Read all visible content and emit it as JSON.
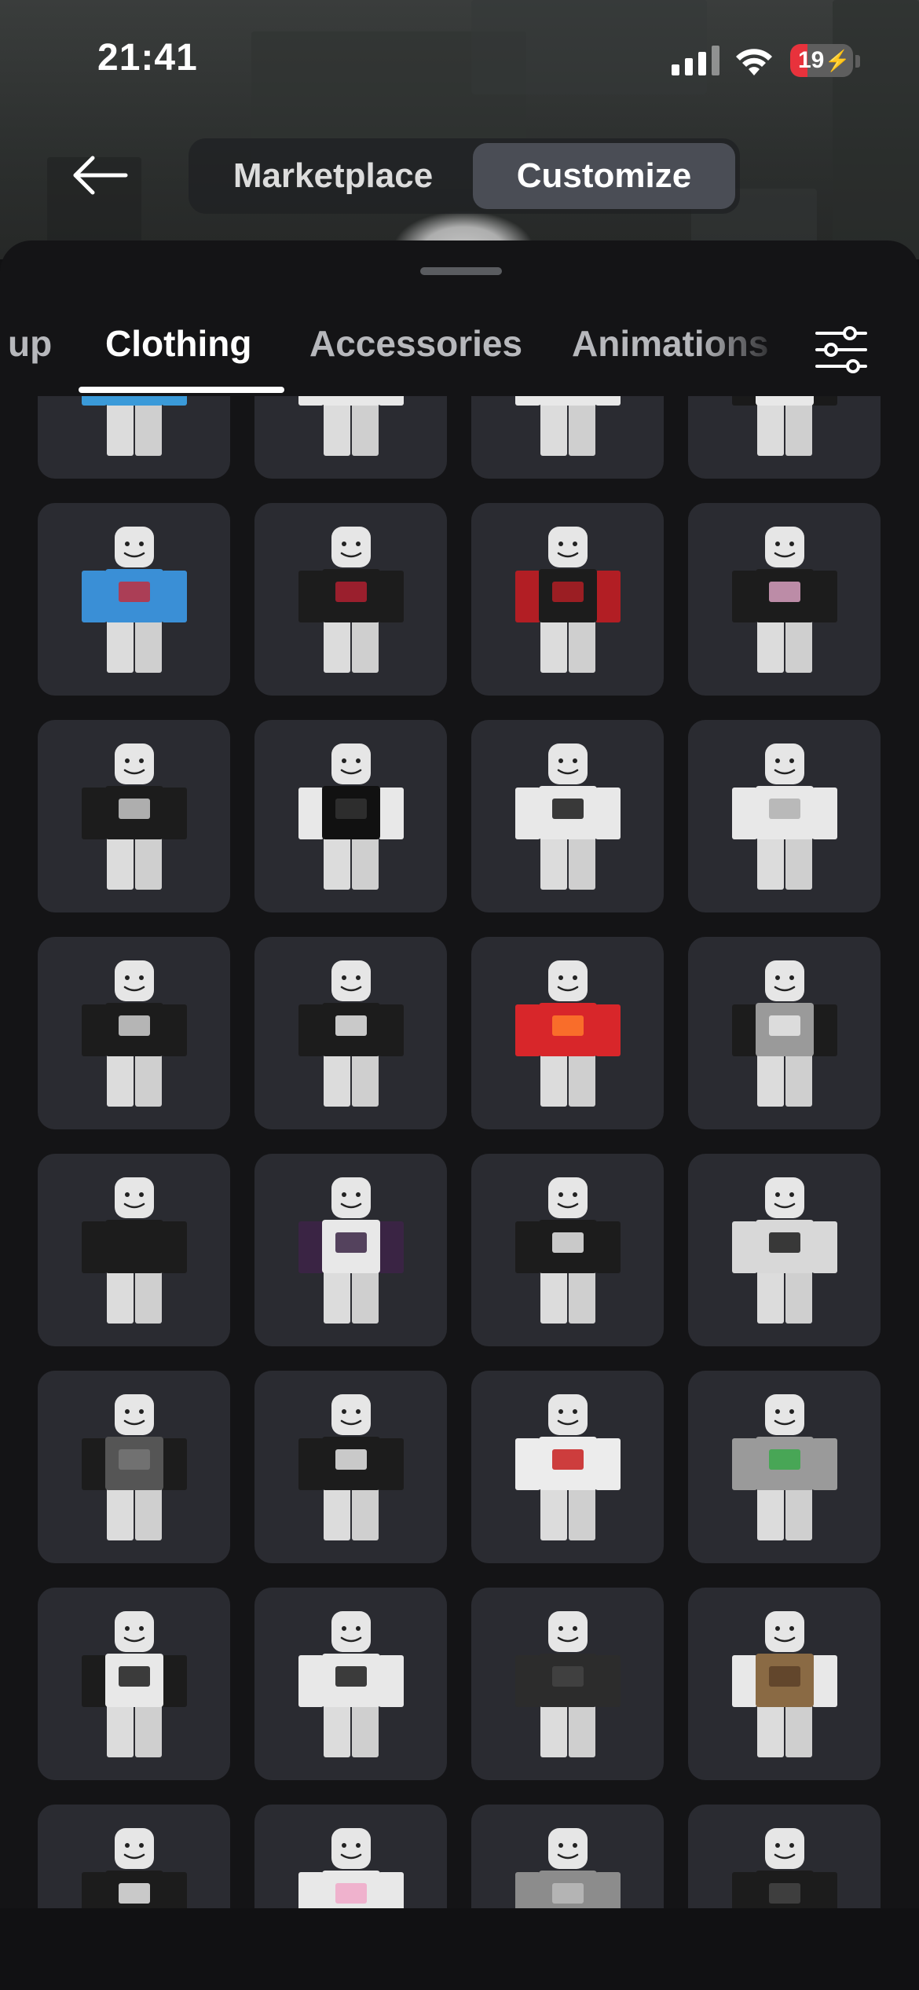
{
  "status_bar": {
    "time": "21:41",
    "battery": "19"
  },
  "nav": {
    "back_label": "←",
    "segments": [
      {
        "label": "Marketplace"
      },
      {
        "label": "Customize"
      }
    ],
    "active_segment": "Customize"
  },
  "tabs": [
    {
      "label": "up"
    },
    {
      "label": "Clothing"
    },
    {
      "label": "Accessories"
    },
    {
      "label": "Animations"
    }
  ],
  "active_tab": "Clothing",
  "colors": {
    "accent": "#ffffff",
    "tile_bg": "#2a2b31",
    "sheet_bg": "#141416",
    "active_segment_bg": "#4a4d55",
    "battery_low": "#e8323c"
  },
  "grid_items": [
    {
      "shirt": "#3a9ad9",
      "sleeve": "#3a9ad9",
      "print": "#d9d9d9"
    },
    {
      "shirt": "#e8e8e8",
      "sleeve": "#e8e8e8",
      "print": "#d0a0c0"
    },
    {
      "shirt": "#e8e8e8",
      "sleeve": "#e8e8e8",
      "print": "#d08030"
    },
    {
      "shirt": "#e8e8e8",
      "sleeve": "#1a1a1a",
      "print": "#1a1a1a"
    },
    {
      "shirt": "#3a8fd6",
      "sleeve": "#3a8fd6",
      "print": "#c03040"
    },
    {
      "shirt": "#1c1c1c",
      "sleeve": "#1c1c1c",
      "print": "#b02030"
    },
    {
      "shirt": "#1c1c1c",
      "sleeve": "#b21e24",
      "print": "#b21e24"
    },
    {
      "shirt": "#1c1c1c",
      "sleeve": "#1c1c1c",
      "print": "#d8a0c0"
    },
    {
      "shirt": "#1c1c1c",
      "sleeve": "#1c1c1c",
      "print": "#c8c8c8"
    },
    {
      "shirt": "#111111",
      "sleeve": "#e8e8e8",
      "print": "#333333"
    },
    {
      "shirt": "#e8e8e8",
      "sleeve": "#e8e8e8",
      "print": "#1a1a1a"
    },
    {
      "shirt": "#e8e8e8",
      "sleeve": "#e8e8e8",
      "print": "#b0b0b0"
    },
    {
      "shirt": "#1c1c1c",
      "sleeve": "#1c1c1c",
      "print": "#d0d0d0"
    },
    {
      "shirt": "#1c1c1c",
      "sleeve": "#1c1c1c",
      "print": "#e8e8e8"
    },
    {
      "shirt": "#d8262a",
      "sleeve": "#d8262a",
      "print": "#ff7a2a"
    },
    {
      "shirt": "#9a9a9a",
      "sleeve": "#1c1c1c",
      "print": "#e8e8e8"
    },
    {
      "shirt": "#1c1c1c",
      "sleeve": "#1c1c1c",
      "print": "#1c1c1c"
    },
    {
      "shirt": "#e8e8e8",
      "sleeve": "#3a2444",
      "print": "#3a2444"
    },
    {
      "shirt": "#1c1c1c",
      "sleeve": "#1c1c1c",
      "print": "#e8e8e8"
    },
    {
      "shirt": "#d8d8d8",
      "sleeve": "#d8d8d8",
      "print": "#1c1c1c"
    },
    {
      "shirt": "#555555",
      "sleeve": "#1c1c1c",
      "print": "#777777"
    },
    {
      "shirt": "#1c1c1c",
      "sleeve": "#1c1c1c",
      "print": "#e8e8e8"
    },
    {
      "shirt": "#ececec",
      "sleeve": "#ececec",
      "print": "#c81e1e"
    },
    {
      "shirt": "#9a9a9a",
      "sleeve": "#9a9a9a",
      "print": "#3aa84a"
    },
    {
      "shirt": "#e8e8e8",
      "sleeve": "#1c1c1c",
      "print": "#1c1c1c"
    },
    {
      "shirt": "#e8e8e8",
      "sleeve": "#e8e8e8",
      "print": "#1c1c1c"
    },
    {
      "shirt": "#2c2c2c",
      "sleeve": "#2c2c2c",
      "print": "#444444"
    },
    {
      "shirt": "#8a6a44",
      "sleeve": "#e8e8e8",
      "print": "#5a4028"
    },
    {
      "shirt": "#1c1c1c",
      "sleeve": "#1c1c1c",
      "print": "#e8e8e8"
    },
    {
      "shirt": "#e8e8e8",
      "sleeve": "#e8e8e8",
      "print": "#f0a8c8"
    },
    {
      "shirt": "#8c8c8c",
      "sleeve": "#8c8c8c",
      "print": "#bbbbbb"
    },
    {
      "shirt": "#1c1c1c",
      "sleeve": "#1c1c1c",
      "print": "#444444"
    }
  ]
}
